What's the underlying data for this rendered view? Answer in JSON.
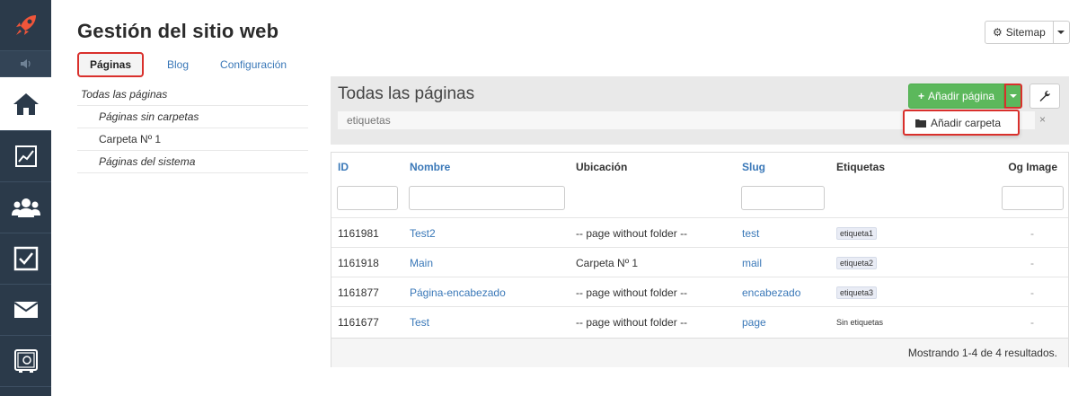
{
  "nav": {
    "items": [
      {
        "icon": "rocket-icon",
        "label": ""
      },
      {
        "icon": "speaker-icon",
        "label": ""
      },
      {
        "icon": "home-icon",
        "label": ""
      },
      {
        "icon": "chart-icon",
        "label": ""
      },
      {
        "icon": "users-icon",
        "label": ""
      },
      {
        "icon": "checkbox-icon",
        "label": ""
      },
      {
        "icon": "mail-icon",
        "label": ""
      },
      {
        "icon": "safe-icon",
        "label": ""
      }
    ]
  },
  "header": {
    "title": "Gestión del sitio web",
    "sitemap_label": "Sitemap"
  },
  "tabs": [
    "Páginas",
    "Blog",
    "Configuración"
  ],
  "sidebar": {
    "items": [
      "Todas las páginas",
      "Páginas sin carpetas",
      "Carpeta Nº 1",
      "Páginas del sistema"
    ]
  },
  "panel": {
    "title": "Todas las páginas",
    "search_placeholder": "etiquetas",
    "clear_label": "×",
    "add_page_label": "Añadir página",
    "dropdown_item": "Añadir carpeta"
  },
  "table": {
    "columns": [
      "ID",
      "Nombre",
      "Ubicación",
      "Slug",
      "Etiquetas",
      "Og Image"
    ],
    "rows": [
      {
        "id": "1161981",
        "name": "Test2",
        "location": "-- page without folder --",
        "slug": "test",
        "tag": "etiqueta1",
        "og": "-"
      },
      {
        "id": "1161918",
        "name": "Main",
        "location": "Carpeta Nº 1",
        "slug": "mail",
        "tag": "etiqueta2",
        "og": "-"
      },
      {
        "id": "1161877",
        "name": "Página-encabezado",
        "location": "-- page without folder --",
        "slug": "encabezado",
        "tag": "etiqueta3",
        "og": "-"
      },
      {
        "id": "1161677",
        "name": "Test",
        "location": "-- page without folder --",
        "slug": "page",
        "tag": "Sin etiquetas",
        "og": "-"
      }
    ],
    "footer": "Mostrando 1-4 de 4 resultados."
  },
  "colors": {
    "nav_bg": "#2b3a4a",
    "accent_orange": "#f0553a",
    "link_blue": "#3a78b8",
    "success_green": "#5cb85c",
    "highlight_red": "#d9302c"
  }
}
